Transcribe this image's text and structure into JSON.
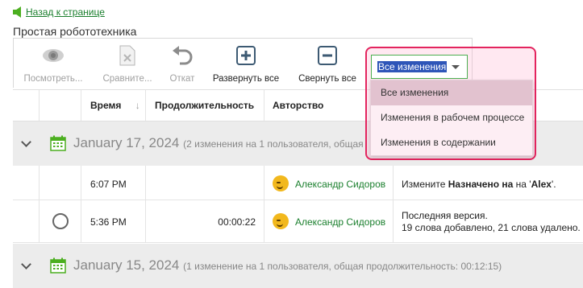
{
  "back_link": "Назад к странице",
  "page_title": "Простая робототехника",
  "toolbar": {
    "view": "Посмотреть...",
    "compare": "Сравните...",
    "revert": "Откат",
    "expand_all": "Развернуть все",
    "collapse_all": "Свернуть все"
  },
  "filter": {
    "selected": "Все изменения",
    "options": [
      "Все изменения",
      "Изменения в рабочем процессе",
      "Изменения в содержании"
    ]
  },
  "table": {
    "headers": {
      "time": "Время",
      "sort_arrow": "↓",
      "duration": "Продолжительность",
      "author": "Авторство"
    }
  },
  "groups": [
    {
      "date": "January 17, 2024",
      "summary": "(2 изменения на 1 пользователя, общая"
    },
    {
      "date": "January 15, 2024",
      "summary": "(1 изменение на 1 пользователя, общая продолжительность: 00:12:15)"
    }
  ],
  "rows": [
    {
      "time": "6:07 PM",
      "duration": "",
      "author": "Александр Сидоров",
      "change_prefix": "Измените ",
      "change_bold": "Назначено на",
      "change_mid": " на '",
      "change_value": "Alex",
      "change_suffix": "'."
    },
    {
      "time": "5:36 PM",
      "duration": "00:00:22",
      "author": "Александр Сидоров",
      "change_line1": "Последняя версия.",
      "change_line2": "19 слова добавлено, 21 слова удалено."
    }
  ],
  "colors": {
    "accent_green": "#1a7f2d",
    "highlight_pink": "#e3245e",
    "selection_blue": "#2e55b8"
  }
}
